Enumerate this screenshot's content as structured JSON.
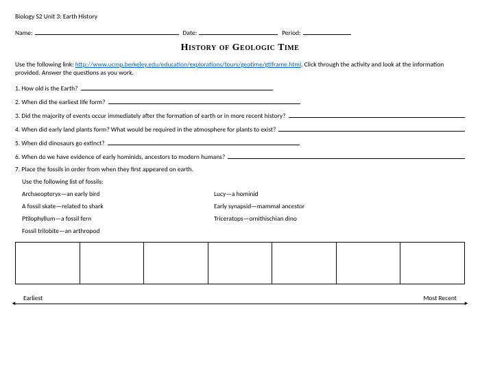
{
  "header": "Biology S2 Unit 3: Earth History",
  "fields": {
    "name_label": "Name:",
    "date_label": "Date:",
    "period_label": "Period:"
  },
  "title": "History of Geologic Time",
  "intro_pre": "Use the following link: ",
  "intro_link": "http://www.ucmp.berkeley.edu/education/explorations/tours/geotime/gtiframe.html",
  "intro_post": ". Click through the activity and look at the information provided.  Answer the questions as you work.",
  "questions": {
    "q1": "1.  How old is the Earth?",
    "q2": "2.  When did the earliest life form?",
    "q3": "3.  Did the majority of events occur immediately after the formation of earth or in more recent history?",
    "q4": "4.  When did early land plants form?  What would be required in the atmosphere for plants to exist?",
    "q5": "5.  When did dinosaurs go extinct?",
    "q6": "6.  When do we have evidence of early hominids, ancestors to modern humans?",
    "q7": "7.  Place the fossils in order from when they first appeared on earth."
  },
  "fossils_intro": "Use the following list of fossils:",
  "fossils": {
    "left": [
      "Archaeopteryx—an early bird",
      "A fossil skate—related to shark",
      "Ptilophyllum—a fossil fern",
      "Fossil trilobite—an arthropod"
    ],
    "right": [
      "Lucy—a hominid",
      "Early synapsid—mammal ancestor",
      "Triceratops—ornithischian dino"
    ]
  },
  "timeline": {
    "left": "Earliest",
    "right": "Most Recent"
  }
}
